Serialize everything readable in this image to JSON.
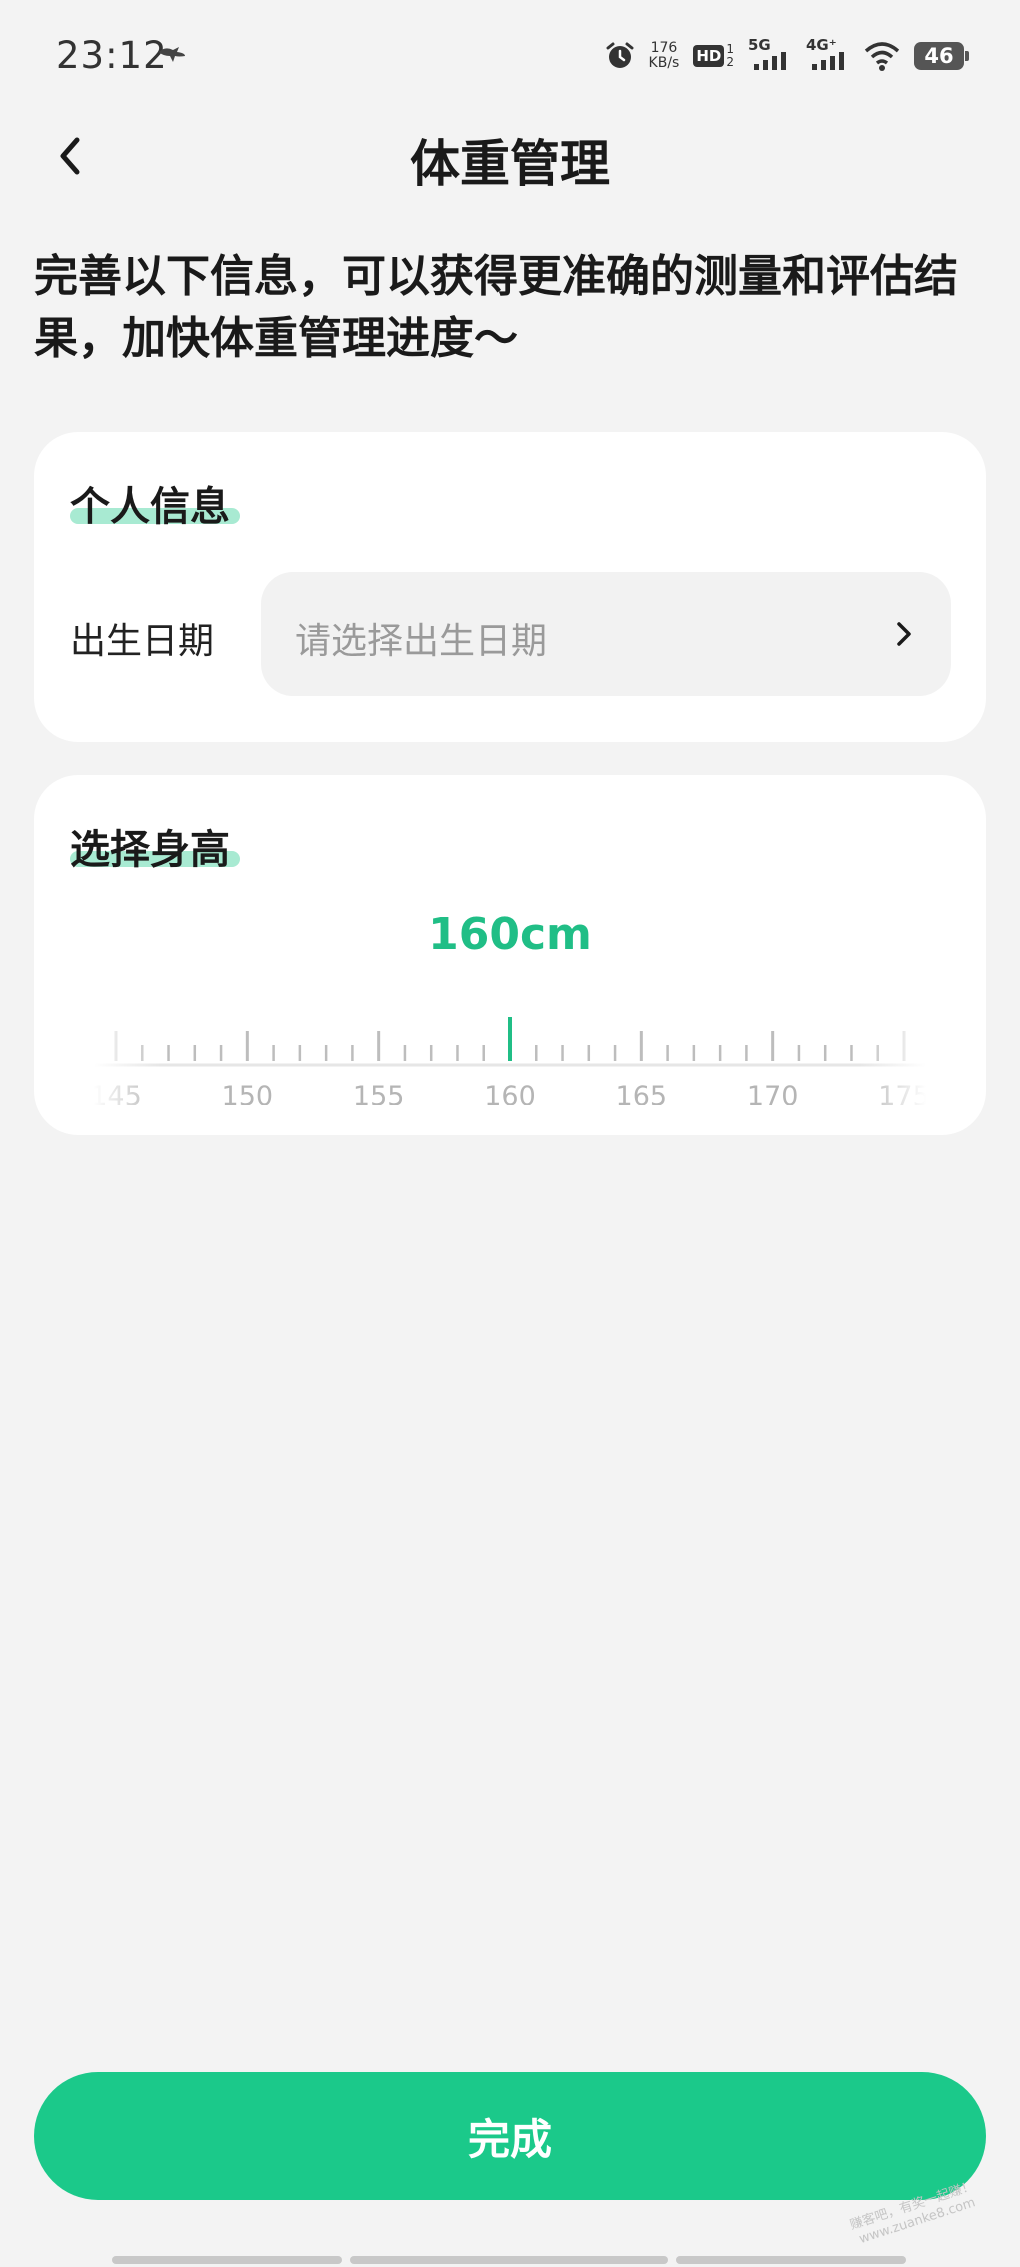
{
  "status_bar": {
    "time": "23:12",
    "speed_value": "176",
    "speed_unit": "KB/s",
    "hd_label": "HD",
    "hd_sup": "1",
    "hd_sub": "2",
    "net1": "5G",
    "net2": "4G⁺",
    "battery": "46"
  },
  "header": {
    "title": "体重管理"
  },
  "intro": "完善以下信息，可以获得更准确的测量和评估结果，加快体重管理进度～",
  "personal_info": {
    "title": "个人信息",
    "birth_label": "出生日期",
    "birth_placeholder": "请选择出生日期"
  },
  "height_picker": {
    "title": "选择身高",
    "value_text": "160cm",
    "selected_cm": 160,
    "range_min": 145,
    "range_max": 175,
    "major_step": 5,
    "minor_per_major": 5,
    "tick_labels": [
      "145",
      "150",
      "155",
      "160",
      "165",
      "170",
      "175"
    ]
  },
  "footer": {
    "done_label": "完成"
  },
  "watermark": {
    "line1": "赚客吧，有奖一起赚！",
    "line2": "www.zuanke8.com"
  },
  "colors": {
    "accent": "#1bc98a",
    "accent_text": "#20be86",
    "highlight": "#a8ead2",
    "background": "#f3f3f3",
    "card": "#ffffff"
  }
}
